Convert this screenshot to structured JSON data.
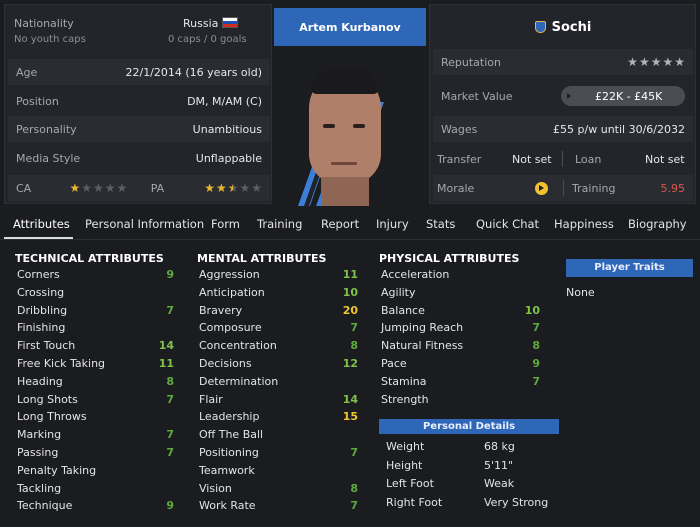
{
  "header": {
    "nationality_label": "Nationality",
    "nationality_value": "Russia",
    "youth_caps": "No youth caps",
    "caps_goals": "0 caps / 0 goals",
    "player_name": "Artem Kurbanov",
    "club_name": "Sochi",
    "colors": {
      "accent": "#2f67b8",
      "star": "#e8b530",
      "green": "#5faa3c",
      "yellow": "#f0c52f",
      "red": "#e0564c"
    }
  },
  "info": {
    "age_label": "Age",
    "age_value": "22/1/2014 (16 years old)",
    "position_label": "Position",
    "position_value": "DM, M/AM (C)",
    "personality_label": "Personality",
    "personality_value": "Unambitious",
    "media_label": "Media Style",
    "media_value": "Unflappable",
    "ca_label": "CA",
    "ca_stars": 1,
    "pa_label": "PA",
    "pa_stars": 2.5
  },
  "right": {
    "reputation_label": "Reputation",
    "reputation_stars": 5,
    "market_label": "Market Value",
    "market_value": "£22K - £45K",
    "wages_label": "Wages",
    "wages_value": "£55 p/w until 30/6/2032",
    "transfer_label": "Transfer",
    "transfer_value": "Not set",
    "loan_label": "Loan",
    "loan_value": "Not set",
    "morale_label": "Morale",
    "training_label": "Training",
    "training_value": "5.95"
  },
  "tabs": [
    "Attributes",
    "Personal Information",
    "Form",
    "Training",
    "Report",
    "Injury",
    "Stats",
    "Quick Chat",
    "Happiness",
    "Biography"
  ],
  "technical": {
    "title": "TECHNICAL ATTRIBUTES",
    "items": [
      {
        "name": "Corners",
        "value": "9"
      },
      {
        "name": "Crossing",
        "value": ""
      },
      {
        "name": "Dribbling",
        "value": "7"
      },
      {
        "name": "Finishing",
        "value": ""
      },
      {
        "name": "First Touch",
        "value": "14"
      },
      {
        "name": "Free Kick Taking",
        "value": "11"
      },
      {
        "name": "Heading",
        "value": "8"
      },
      {
        "name": "Long Shots",
        "value": "7"
      },
      {
        "name": "Long Throws",
        "value": ""
      },
      {
        "name": "Marking",
        "value": "7"
      },
      {
        "name": "Passing",
        "value": "7"
      },
      {
        "name": "Penalty Taking",
        "value": ""
      },
      {
        "name": "Tackling",
        "value": ""
      },
      {
        "name": "Technique",
        "value": "9"
      }
    ]
  },
  "mental": {
    "title": "MENTAL ATTRIBUTES",
    "items": [
      {
        "name": "Aggression",
        "value": "11"
      },
      {
        "name": "Anticipation",
        "value": "10"
      },
      {
        "name": "Bravery",
        "value": "20"
      },
      {
        "name": "Composure",
        "value": "7"
      },
      {
        "name": "Concentration",
        "value": "8"
      },
      {
        "name": "Decisions",
        "value": "12"
      },
      {
        "name": "Determination",
        "value": ""
      },
      {
        "name": "Flair",
        "value": "14"
      },
      {
        "name": "Leadership",
        "value": "15"
      },
      {
        "name": "Off The Ball",
        "value": ""
      },
      {
        "name": "Positioning",
        "value": "7"
      },
      {
        "name": "Teamwork",
        "value": ""
      },
      {
        "name": "Vision",
        "value": "8"
      },
      {
        "name": "Work Rate",
        "value": "7"
      }
    ]
  },
  "physical": {
    "title": "PHYSICAL ATTRIBUTES",
    "items": [
      {
        "name": "Acceleration",
        "value": ""
      },
      {
        "name": "Agility",
        "value": ""
      },
      {
        "name": "Balance",
        "value": "10"
      },
      {
        "name": "Jumping Reach",
        "value": "7"
      },
      {
        "name": "Natural Fitness",
        "value": "8"
      },
      {
        "name": "Pace",
        "value": "9"
      },
      {
        "name": "Stamina",
        "value": "7"
      },
      {
        "name": "Strength",
        "value": ""
      }
    ]
  },
  "personal": {
    "title": "Personal Details",
    "weight_label": "Weight",
    "weight_value": "68 kg",
    "height_label": "Height",
    "height_value": "5'11\"",
    "left_label": "Left Foot",
    "left_value": "Weak",
    "right_label": "Right Foot",
    "right_value": "Very Strong"
  },
  "traits": {
    "title": "Player Traits",
    "value": "None"
  }
}
